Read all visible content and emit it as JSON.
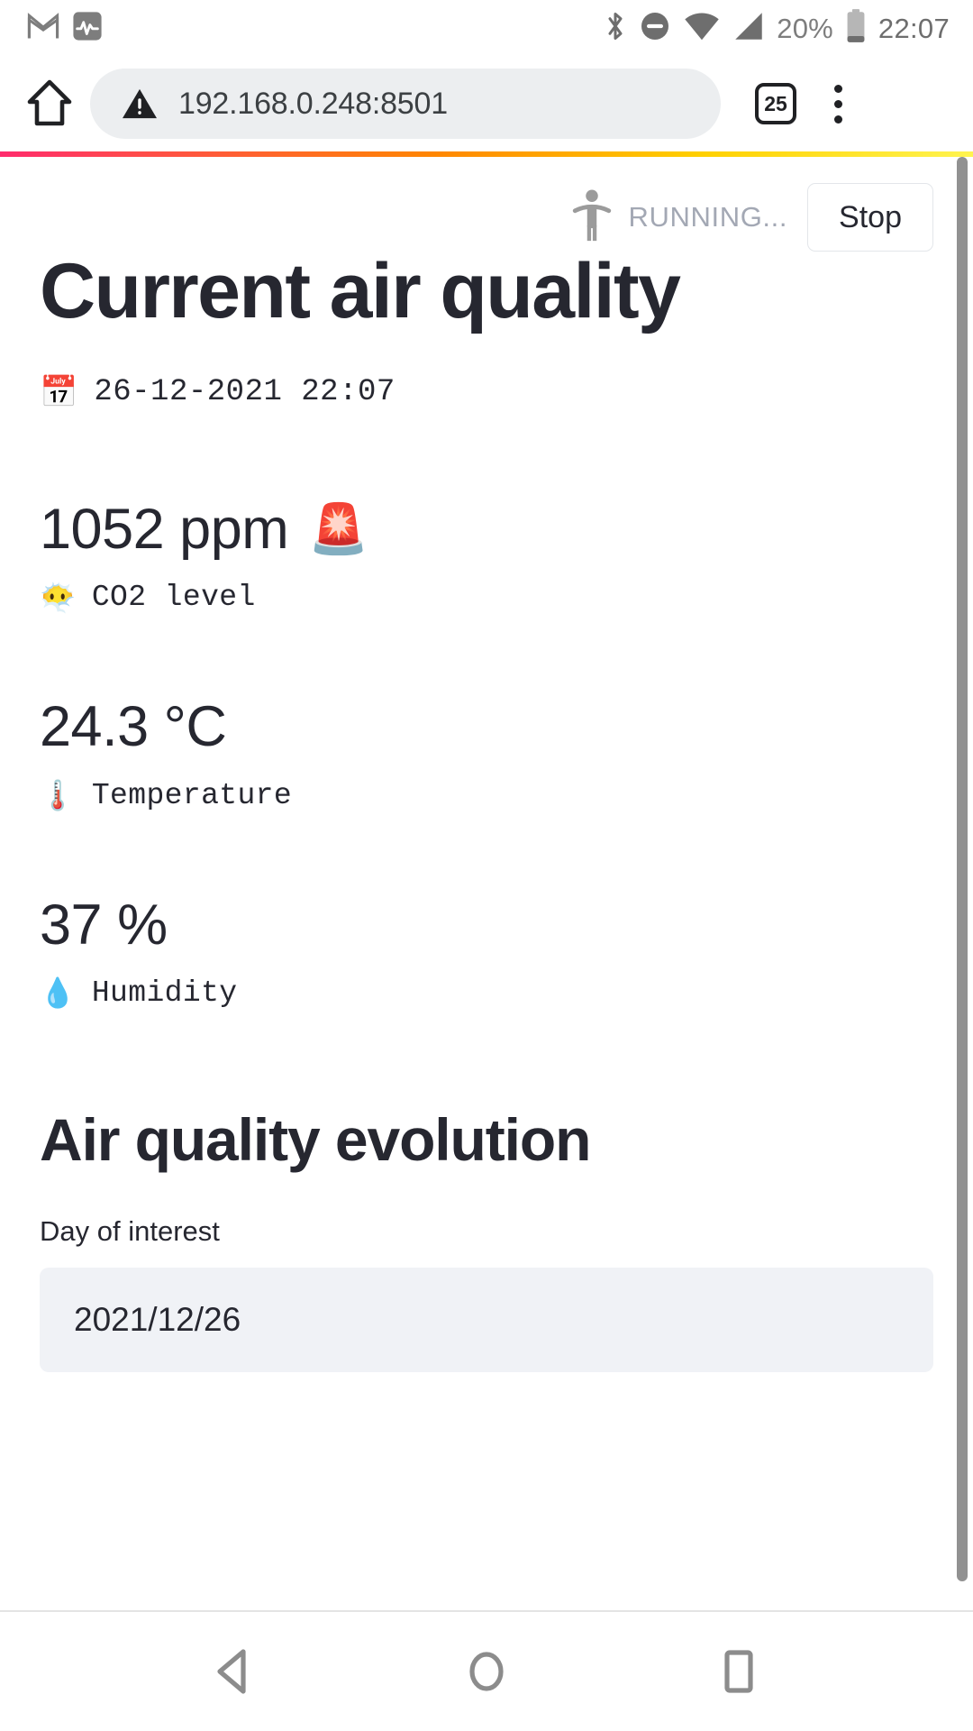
{
  "status_bar": {
    "left_icons": [
      "gmail-icon",
      "activity-monitor-icon"
    ],
    "right_icons": [
      "bluetooth-icon",
      "do-not-disturb-icon",
      "wifi-icon",
      "cellular-signal-icon"
    ],
    "battery_percent": "20%",
    "clock": "22:07"
  },
  "browser": {
    "home_icon": "home-icon",
    "security_icon": "insecure-warning-icon",
    "url": "192.168.0.248:8501",
    "tab_count": "25",
    "menu_icon": "overflow-menu-icon"
  },
  "app": {
    "runner_icon": "running-man-icon",
    "running_status": "RUNNING...",
    "stop_label": "Stop",
    "title": "Current air quality",
    "datetime_emoji": "📅",
    "datetime": "26-12-2021 22:07",
    "metrics": [
      {
        "value": "1052 ppm",
        "value_emoji": "🚨",
        "label_emoji": "😶‍🌫️",
        "label": "CO2 level"
      },
      {
        "value": "24.3 °C",
        "value_emoji": "",
        "label_emoji": "🌡️",
        "label": "Temperature"
      },
      {
        "value": "37 %",
        "value_emoji": "",
        "label_emoji": "💧",
        "label": "Humidity"
      }
    ],
    "section_title": "Air quality evolution",
    "date_field_label": "Day of interest",
    "date_field_value": "2021/12/26"
  },
  "android_nav": {
    "back": "back-triangle-icon",
    "home": "home-circle-icon",
    "recents": "recents-square-icon"
  },
  "colors": {
    "text": "#262730",
    "muted": "#a3a8b4",
    "input_bg": "#f0f2f6",
    "omnibox_bg": "#eceef0",
    "gradient_start": "#ff2b6d",
    "gradient_end": "#fff44f"
  }
}
